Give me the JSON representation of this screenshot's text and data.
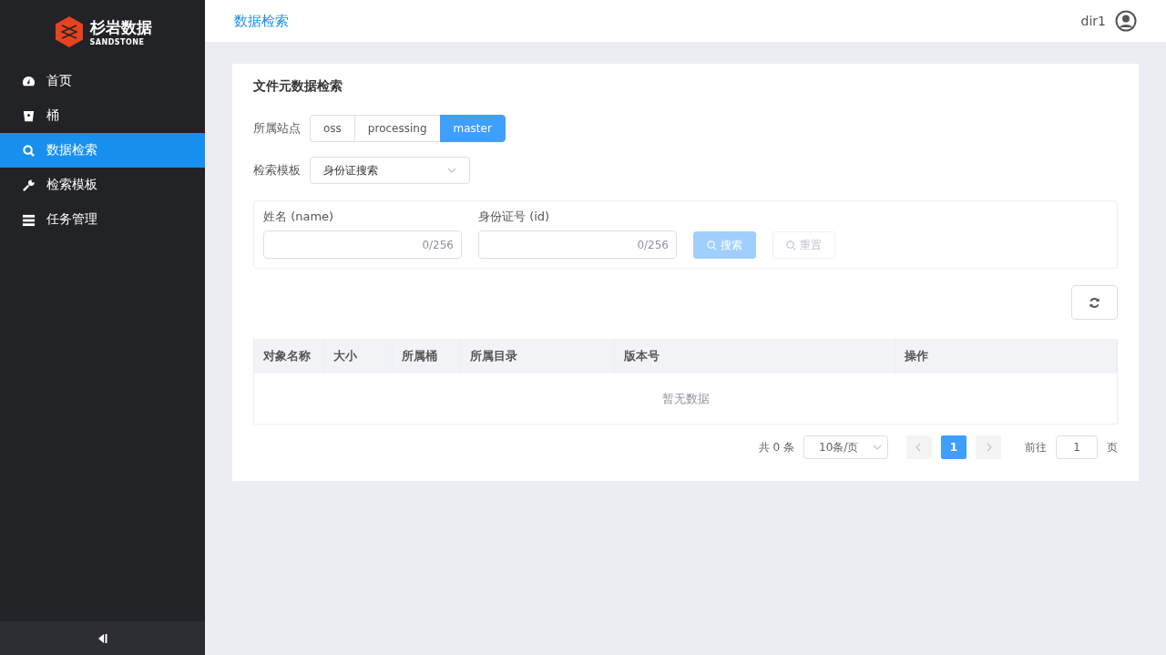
{
  "logo": {
    "name": "杉岩数据",
    "subtitle": "SANDSTONE"
  },
  "sidebar": {
    "items": [
      {
        "label": "首页",
        "selected": false
      },
      {
        "label": "桶",
        "selected": false
      },
      {
        "label": "数据检索",
        "selected": true
      },
      {
        "label": "检索模板",
        "selected": false
      },
      {
        "label": "任务管理",
        "selected": false
      }
    ]
  },
  "header": {
    "title": "数据检索",
    "user": "dir1"
  },
  "card": {
    "title": "文件元数据检索",
    "site": {
      "label": "所属站点",
      "options": [
        {
          "label": "oss",
          "selected": false
        },
        {
          "label": "processing",
          "selected": false
        },
        {
          "label": "master",
          "selected": true
        }
      ]
    },
    "template": {
      "label": "检索模板",
      "value": "身份证搜索"
    },
    "fields": [
      {
        "label": "姓名 (name)",
        "count": "0/256"
      },
      {
        "label": "身份证号 (id)",
        "count": "0/256"
      }
    ],
    "search_button": {
      "label": "搜索",
      "disabled": true
    },
    "reset_button": {
      "label": "重置",
      "disabled": true
    },
    "table": {
      "columns": [
        "对象名称",
        "大小",
        "所属桶",
        "所属目录",
        "版本号",
        "操作"
      ],
      "empty_text": "暂无数据"
    },
    "pagination": {
      "total": "共 0 条",
      "page_size": "10条/页",
      "pages": [
        {
          "label": "1",
          "selected": true
        }
      ],
      "goto_label": "前往",
      "goto_value": "1",
      "goto_suffix": "页"
    }
  }
}
